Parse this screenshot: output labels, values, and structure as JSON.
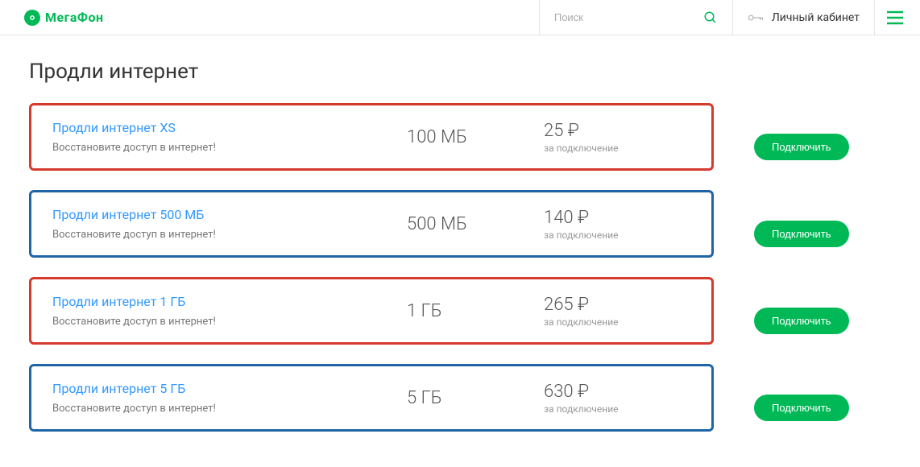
{
  "header": {
    "brand": "МегаФон",
    "search_placeholder": "Поиск",
    "cabinet": "Личный кабинет"
  },
  "page": {
    "title": "Продли интернет"
  },
  "plans": [
    {
      "title": "Продли интернет XS",
      "subtitle": "Восстановите доступ в интернет!",
      "amount": "100 МБ",
      "price": "25 ₽",
      "price_sub": "за подключение",
      "button": "Подключить",
      "border": "red"
    },
    {
      "title": "Продли интернет 500 МБ",
      "subtitle": "Восстановите доступ в интернет!",
      "amount": "500 МБ",
      "price": "140 ₽",
      "price_sub": "за подключение",
      "button": "Подключить",
      "border": "blue"
    },
    {
      "title": "Продли интернет 1 ГБ",
      "subtitle": "Восстановите доступ в интернет!",
      "amount": "1 ГБ",
      "price": "265 ₽",
      "price_sub": "за подключение",
      "button": "Подключить",
      "border": "red"
    },
    {
      "title": "Продли интернет 5 ГБ",
      "subtitle": "Восстановите доступ в интернет!",
      "amount": "5 ГБ",
      "price": "630 ₽",
      "price_sub": "за подключение",
      "button": "Подключить",
      "border": "blue"
    }
  ]
}
